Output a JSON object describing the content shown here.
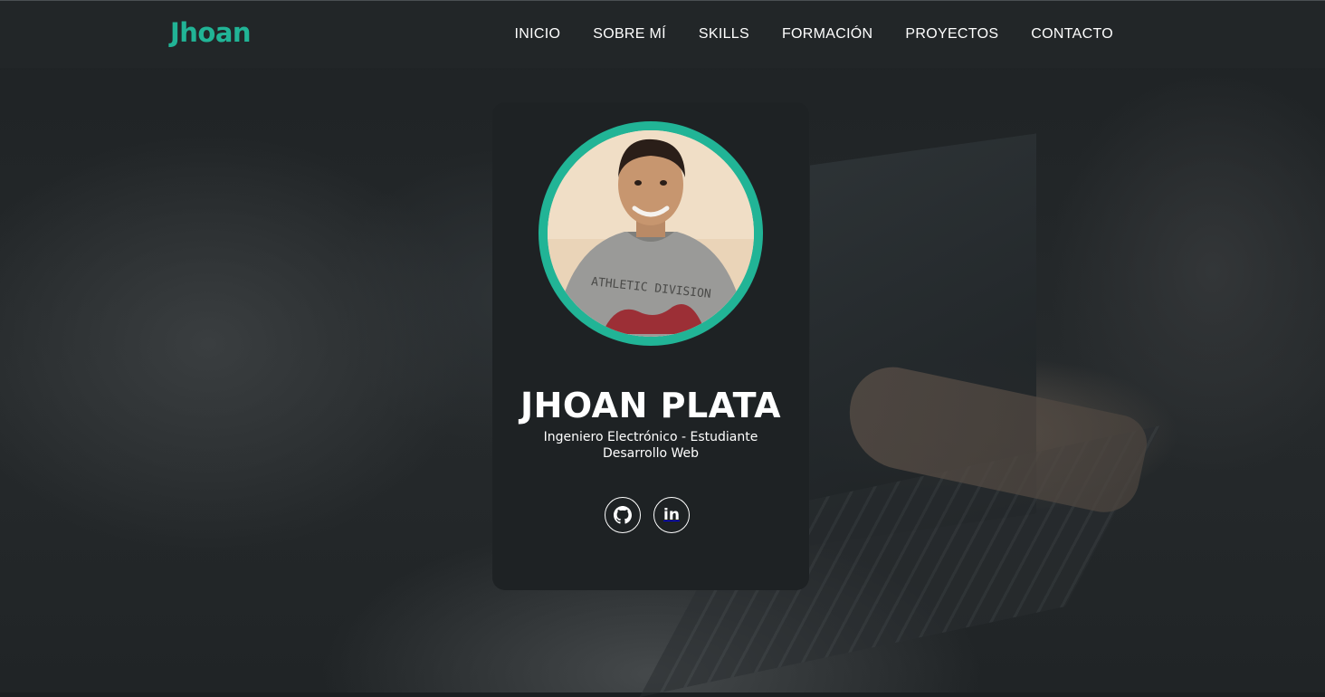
{
  "header": {
    "logo": "Jhoan",
    "nav": [
      "INICIO",
      "SOBRE MÍ",
      "SKILLS",
      "FORMACIÓN",
      "PROYECTOS",
      "CONTACTO"
    ]
  },
  "profile": {
    "name": "JHOAN PLATA",
    "subtitle_line1": "Ingeniero Electrónico - Estudiante",
    "subtitle_line2": "Desarrollo Web",
    "photo_shirt_text": "ATHLETIC DIVISION",
    "socials": [
      {
        "icon": "github-icon",
        "label": ""
      },
      {
        "icon": "linkedin-icon",
        "label": "in"
      }
    ]
  },
  "colors": {
    "accent": "#21b496",
    "header_bg": "#222628",
    "card_bg": "#1e2224",
    "text": "#ffffff"
  }
}
